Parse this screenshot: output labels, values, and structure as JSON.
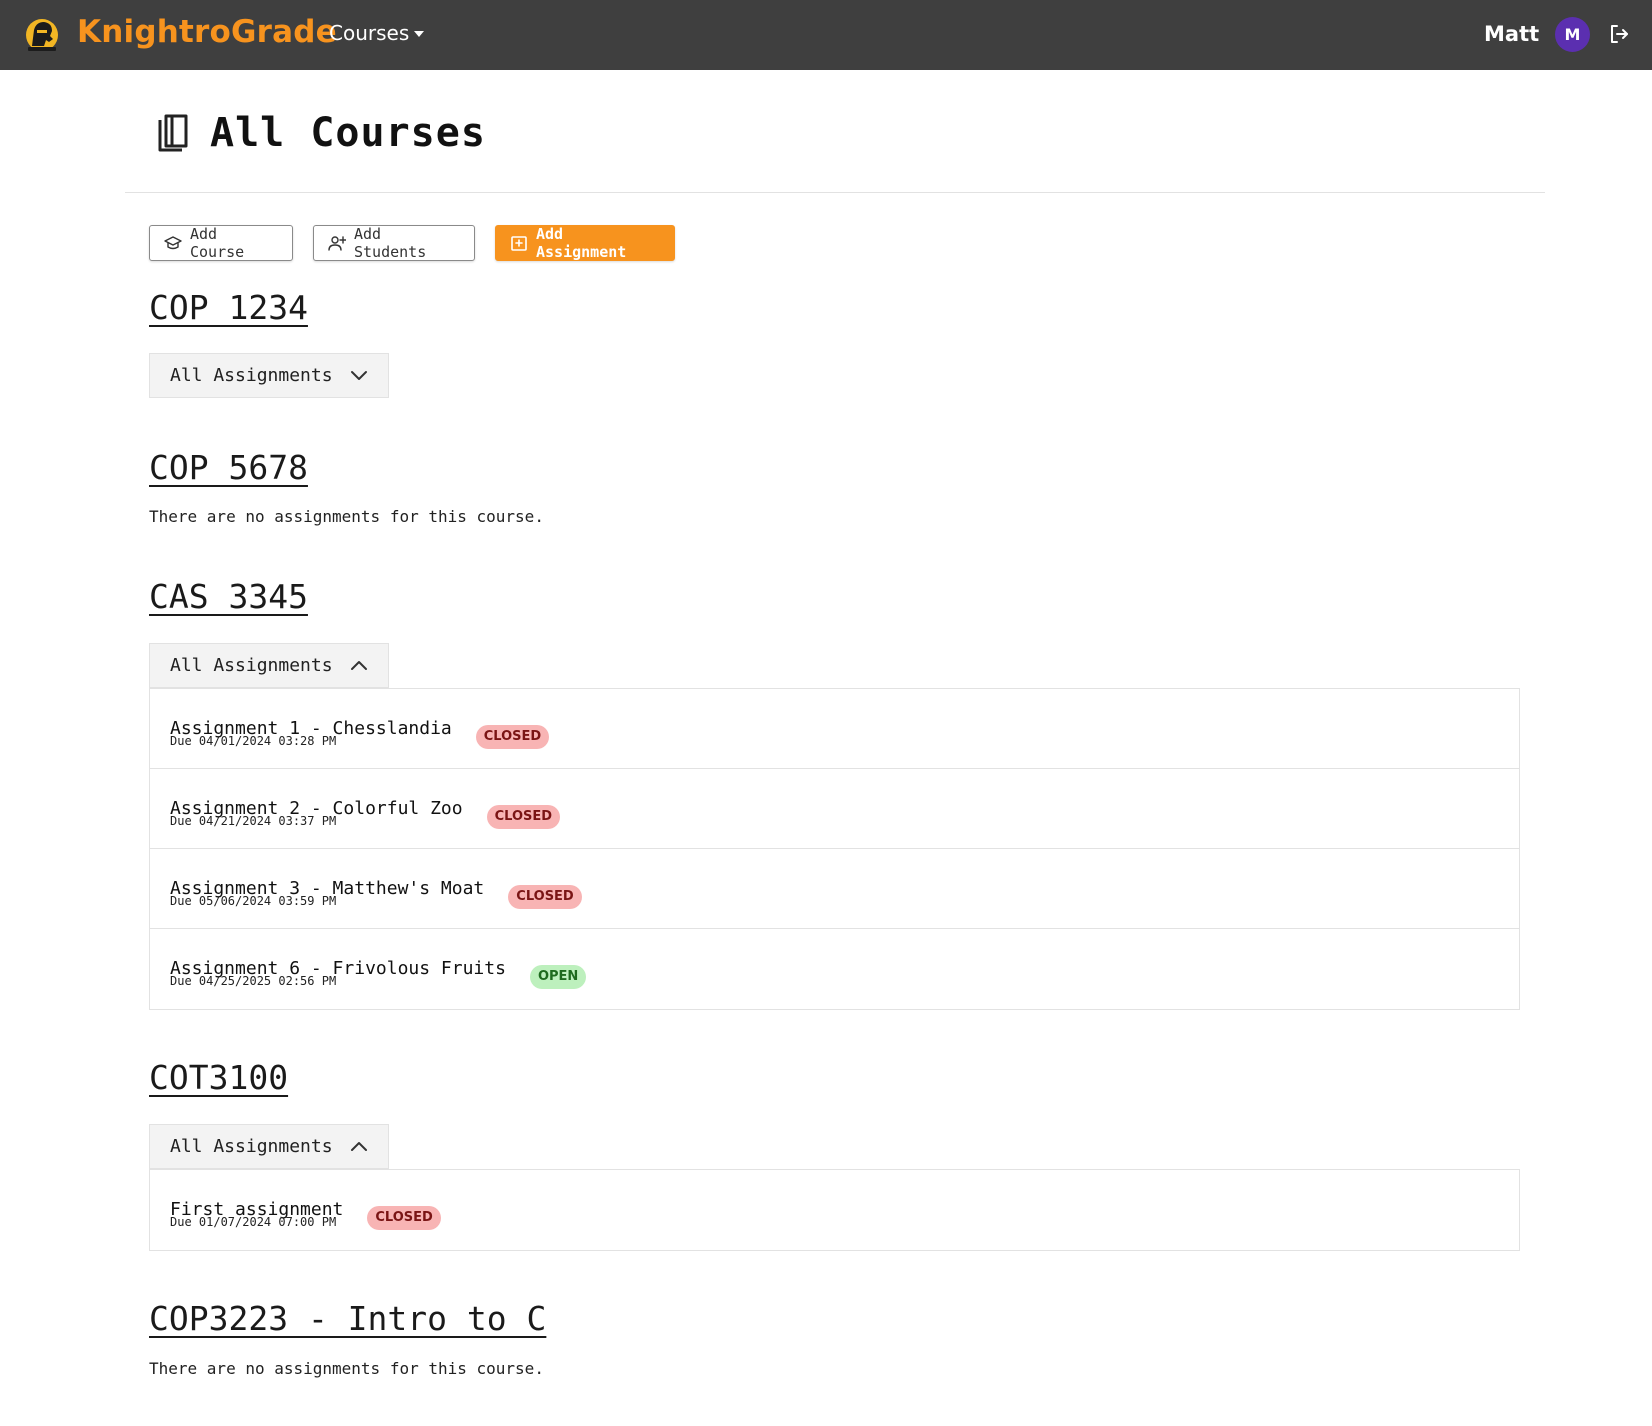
{
  "navbar": {
    "brand": "KnightroGrade",
    "courses_menu": "Courses",
    "user_name": "Matt",
    "avatar_initial": "M"
  },
  "page": {
    "title": "All Courses"
  },
  "toolbar": {
    "add_course": "Add Course",
    "add_students": "Add Students",
    "add_assignment": "Add Assignment",
    "accent_color": "#f7931e"
  },
  "courses": [
    {
      "name": "COP 1234",
      "accordion_label": "All Assignments",
      "expanded": false
    },
    {
      "name": "COP 5678",
      "empty_message": "There are no assignments for this course."
    },
    {
      "name": "CAS 3345",
      "accordion_label": "All Assignments",
      "expanded": true,
      "assignments": [
        {
          "name": "Assignment 1 - Chesslandia",
          "status": "CLOSED",
          "due": "Due 04/01/2024 03:28 PM"
        },
        {
          "name": "Assignment 2 - Colorful Zoo",
          "status": "CLOSED",
          "due": "Due 04/21/2024 03:37 PM"
        },
        {
          "name": "Assignment 3 - Matthew's Moat",
          "status": "CLOSED",
          "due": "Due 05/06/2024 03:59 PM"
        },
        {
          "name": "Assignment 6 - Frivolous Fruits",
          "status": "OPEN",
          "due": "Due 04/25/2025 02:56 PM"
        }
      ]
    },
    {
      "name": "COT3100",
      "accordion_label": "All Assignments",
      "expanded": true,
      "assignments": [
        {
          "name": "First assignment",
          "status": "CLOSED",
          "due": "Due 01/07/2024 07:00 PM"
        }
      ]
    },
    {
      "name": "COP3223 - Intro to C",
      "empty_message": "There are no assignments for this course."
    }
  ],
  "colors": {
    "navbar_bg": "#3f3f3f",
    "closed_badge": "#f8b4b4",
    "open_badge": "#bdf0bd",
    "avatar_bg": "#5b2fb0"
  },
  "icons": [
    "knight-logo-icon",
    "caret-down-icon",
    "logout-icon",
    "book-icon",
    "graduation-cap-icon",
    "user-plus-icon",
    "add-document-icon",
    "chevron-down-icon",
    "chevron-up-icon"
  ]
}
